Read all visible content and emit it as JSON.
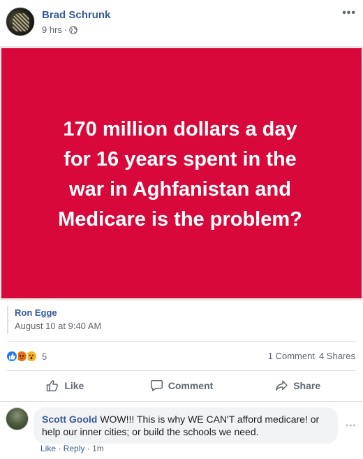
{
  "post": {
    "author": "Brad Schrunk",
    "time": "9 hrs",
    "separator": "·",
    "more_icon": "more-horizontal-icon",
    "privacy_icon": "globe-icon"
  },
  "image": {
    "background_color": "#d8093a",
    "text_lines": [
      "170 million dollars a day",
      "for 16 years spent in the",
      "war in Aghfanistan and",
      "Medicare is the problem?"
    ]
  },
  "shared_from": {
    "name": "Ron Egge",
    "date": "August 10 at 9:40 AM"
  },
  "reactions": {
    "types": [
      "like",
      "angry",
      "wow"
    ],
    "count": "5",
    "comments": "1 Comment",
    "shares": "4 Shares"
  },
  "actions": {
    "like": "Like",
    "comment": "Comment",
    "share": "Share"
  },
  "comment": {
    "author": "Scott Goold",
    "text": "WOW!!! This is why WE CAN'T afford medicare! or help our inner cities; or build the schools we need.",
    "like": "Like",
    "reply": "Reply",
    "separator": "·",
    "time": "1m"
  },
  "colors": {
    "link_blue": "#365899",
    "muted": "#616770",
    "like_blue": "#2078f4"
  }
}
